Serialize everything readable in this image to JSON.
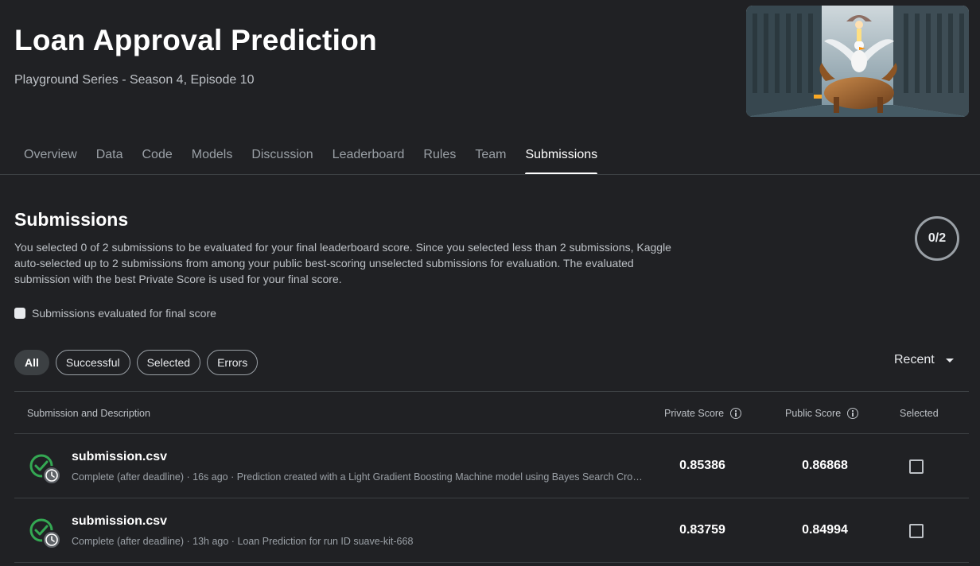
{
  "header": {
    "title": "Loan Approval Prediction",
    "subtitle": "Playground Series - Season 4, Episode 10"
  },
  "tabs": [
    {
      "label": "Overview"
    },
    {
      "label": "Data"
    },
    {
      "label": "Code"
    },
    {
      "label": "Models"
    },
    {
      "label": "Discussion"
    },
    {
      "label": "Leaderboard"
    },
    {
      "label": "Rules"
    },
    {
      "label": "Team"
    },
    {
      "label": "Submissions",
      "active": true
    }
  ],
  "submissions": {
    "title": "Submissions",
    "description": "You selected 0 of 2 submissions to be evaluated for your final leaderboard score. Since you selected less than 2 submissions, Kaggle auto-selected up to 2 submissions from among your public best-scoring unselected submissions for evaluation. The evaluated submission with the best Private Score is used for your final score.",
    "counter": "0/2",
    "final_score_label": "Submissions evaluated for final score",
    "filters": [
      "All",
      "Successful",
      "Selected",
      "Errors"
    ],
    "active_filter": "All",
    "sort_label": "Recent"
  },
  "table": {
    "headers": {
      "submission": "Submission and Description",
      "private": "Private Score",
      "public": "Public Score",
      "selected": "Selected"
    },
    "rows": [
      {
        "filename": "submission.csv",
        "meta": "Complete (after deadline) · 16s ago · Prediction created with a Light Gradient Boosting Machine model using Bayes Search Cross Validation",
        "private_score": "0.85386",
        "public_score": "0.86868",
        "selected": false
      },
      {
        "filename": "submission.csv",
        "meta": "Complete (after deadline) · 13h ago · Loan Prediction for run ID suave-kit-668",
        "private_score": "0.83759",
        "public_score": "0.84994",
        "selected": false
      }
    ]
  },
  "colors": {
    "background": "#202124",
    "status_success": "#34a853",
    "text_primary": "#ffffff",
    "text_secondary": "#bdc1c6"
  },
  "icons": {
    "status": "check-circle-icon",
    "clock": "clock-icon",
    "info": "info-icon",
    "sort": "caret-down-icon"
  }
}
